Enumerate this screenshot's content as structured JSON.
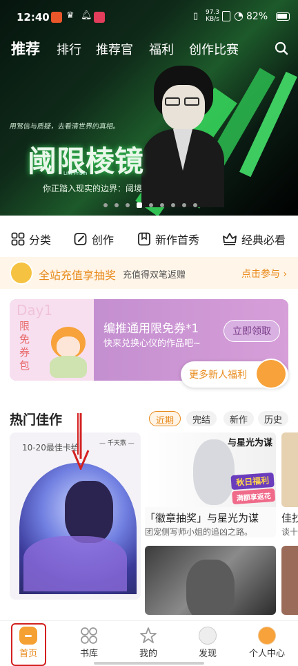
{
  "status_bar": {
    "time": "12:40",
    "net_speed": "97.3",
    "net_unit": "KB/s",
    "battery": "82%"
  },
  "top_nav": {
    "tabs": [
      "推荐",
      "排行",
      "推荐官",
      "福利",
      "创作比赛"
    ]
  },
  "banner": {
    "tagline": "用驾信与质疑，去看清世界的真相。",
    "title": "阈限棱镜",
    "subtitle_en": "Lim Prism",
    "caption": "你正踏入现实的边界：阈境",
    "dot_count": 9,
    "active_dot": 3
  },
  "categories": [
    {
      "label": "分类",
      "icon": "grid-icon"
    },
    {
      "label": "创作",
      "icon": "edit-icon"
    },
    {
      "label": "新作首秀",
      "icon": "bookmark-icon"
    },
    {
      "label": "经典必看",
      "icon": "crown-icon"
    }
  ],
  "promo": {
    "title": "全站充值享抽奖",
    "desc": "充值得双笔返赠",
    "action": "点击参与 ›"
  },
  "coupon": {
    "day": "Day1",
    "side_text": "限免券包",
    "title": "编推通用限免券*1",
    "desc": "快来兑换心仪的作品吧~",
    "button": "立即领取",
    "more": "更多新人福利"
  },
  "hot": {
    "title": "热门佳作",
    "tabs": [
      "近期",
      "完结",
      "新作",
      "历史"
    ],
    "active_tab": 0,
    "cards": [
      {
        "cover_text": "10-20最佳卡给",
        "tag": "— 千天燕 —"
      },
      {
        "title": "「徽章抽奖」与星光为谋",
        "desc": "团宠侧写师小姐的追凶之路。",
        "badge_top": "秋日福利",
        "badge_bottom": "满额享返花",
        "logo": "与星光为谋"
      },
      {
        "title": "佳抄",
        "desc": "谈十"
      }
    ]
  },
  "bottom_nav": {
    "items": [
      "首页",
      "书库",
      "我的",
      "发现",
      "个人中心"
    ],
    "active": 0
  },
  "colors": {
    "accent": "#e88a1b",
    "highlight": "#d32020",
    "banner_green": "#35d35a"
  }
}
